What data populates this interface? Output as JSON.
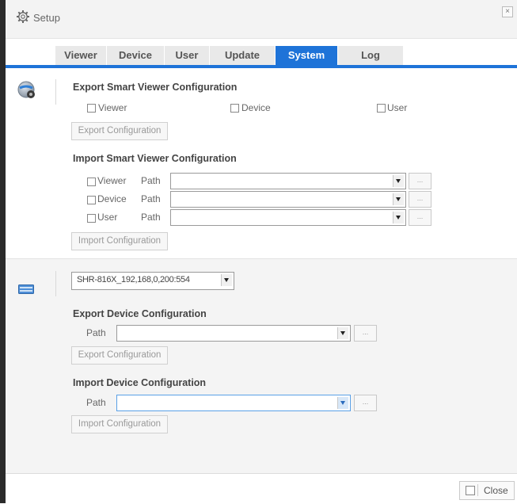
{
  "window": {
    "title": "Setup",
    "close_glyph": "×"
  },
  "tabs": [
    {
      "label": "Viewer"
    },
    {
      "label": "Device"
    },
    {
      "label": "User"
    },
    {
      "label": "Update"
    },
    {
      "label": "System",
      "active": true
    },
    {
      "label": "Log"
    }
  ],
  "smart_viewer": {
    "export": {
      "heading": "Export Smart Viewer Configuration",
      "options": [
        "Viewer",
        "Device",
        "User"
      ],
      "button": "Export Configuration"
    },
    "import": {
      "heading": "Import Smart Viewer Configuration",
      "rows": [
        {
          "label": "Viewer",
          "path_label": "Path",
          "path_value": ""
        },
        {
          "label": "Device",
          "path_label": "Path",
          "path_value": ""
        },
        {
          "label": "User",
          "path_label": "Path",
          "path_value": ""
        }
      ],
      "browse_label": "...",
      "button": "Import Configuration"
    }
  },
  "device_config": {
    "selected_device": "SHR-816X_192,168,0,200:554",
    "export": {
      "heading": "Export Device Configuration",
      "path_label": "Path",
      "path_value": "",
      "browse_label": "...",
      "button": "Export Configuration"
    },
    "import": {
      "heading": "Import Device Configuration",
      "path_label": "Path",
      "path_value": "",
      "browse_label": "...",
      "button": "Import Configuration"
    }
  },
  "footer": {
    "close_label": "Close"
  },
  "colors": {
    "accent": "#1e73d8",
    "tab_inactive": "#e9e9e9",
    "section_bg": "#f4f4f4"
  },
  "icons": [
    "gear-icon",
    "settings-globe-icon",
    "device-icon",
    "close-icon",
    "dropdown-arrow-icon",
    "checkbox-icon"
  ]
}
